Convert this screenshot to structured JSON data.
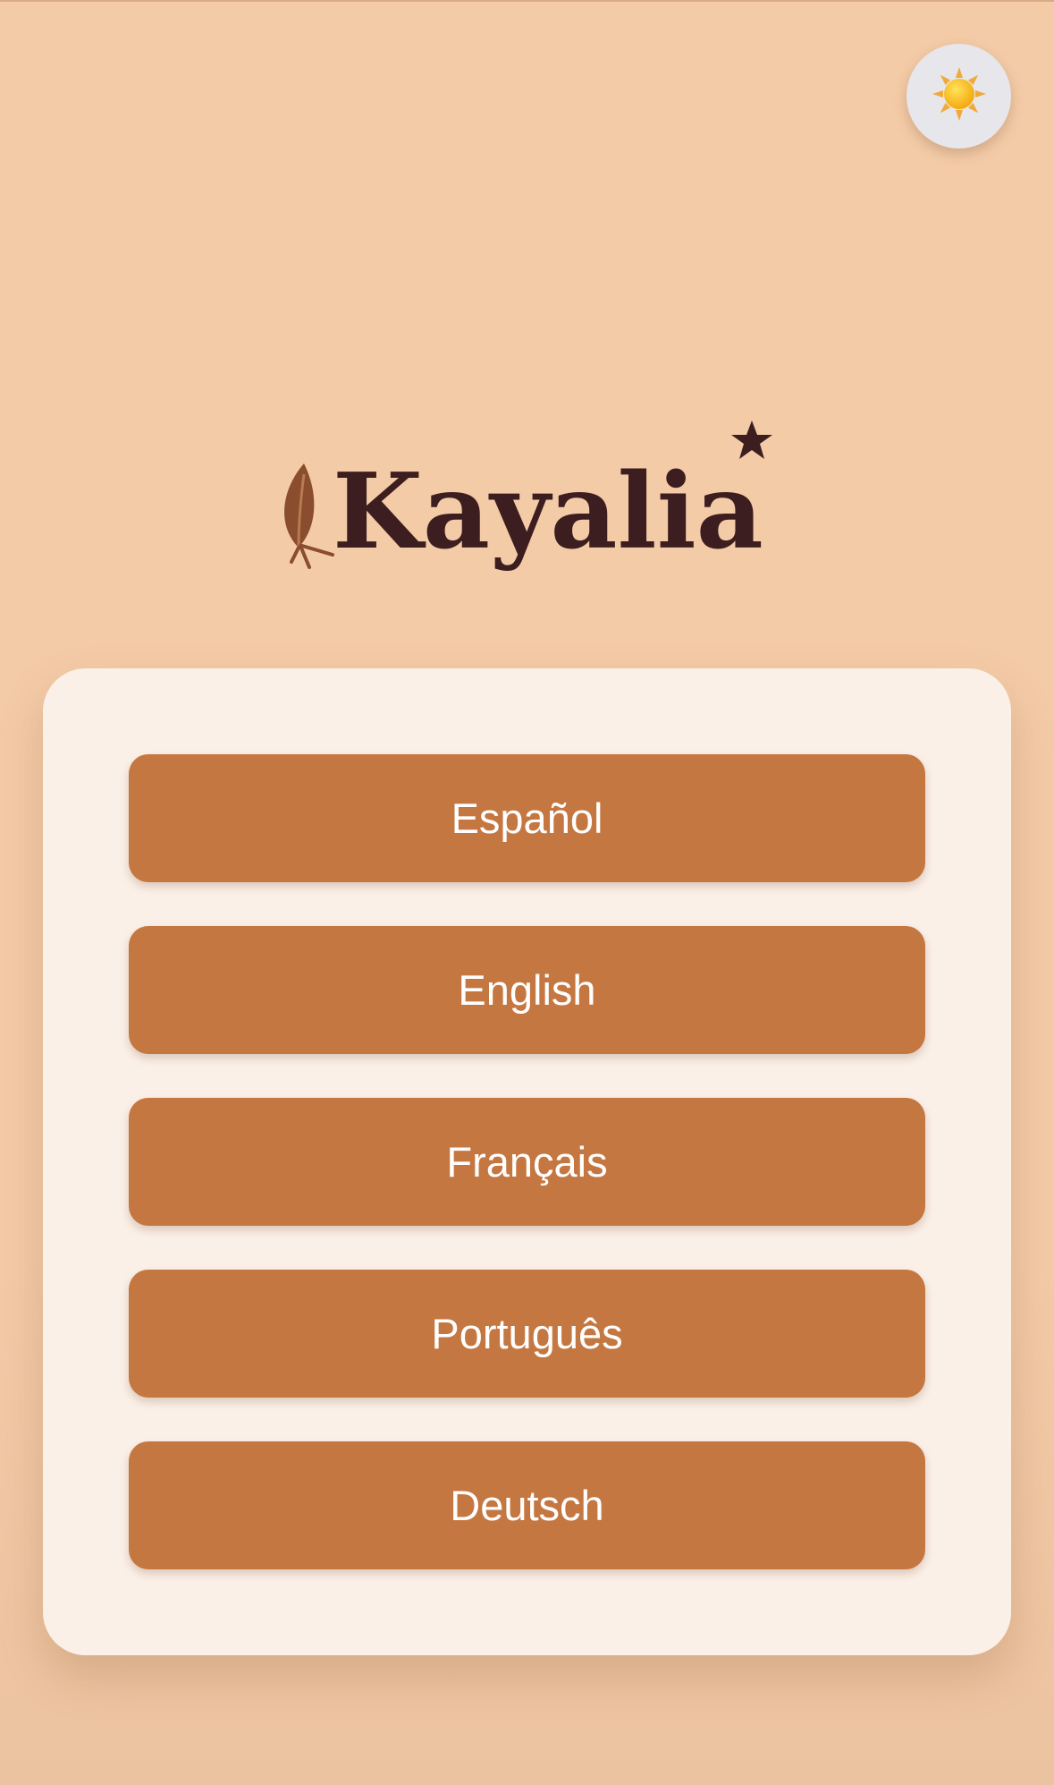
{
  "theme_toggle": {
    "icon": "sun-icon"
  },
  "logo": {
    "text": "Kayalia",
    "text_color": "#3d1e20",
    "leaf_color": "#8a4d2d",
    "icons": [
      "leaf-icon",
      "star-icon"
    ]
  },
  "languages": [
    {
      "label": "Español"
    },
    {
      "label": "English"
    },
    {
      "label": "Français"
    },
    {
      "label": "Português"
    },
    {
      "label": "Deutsch"
    }
  ],
  "colors": {
    "background": "#f4cba7",
    "card": "#fbf0e8",
    "button": "#c57741",
    "button_text": "#ffffff",
    "toggle_bg": "#e7e6ea",
    "sun": "#f6b81d"
  }
}
